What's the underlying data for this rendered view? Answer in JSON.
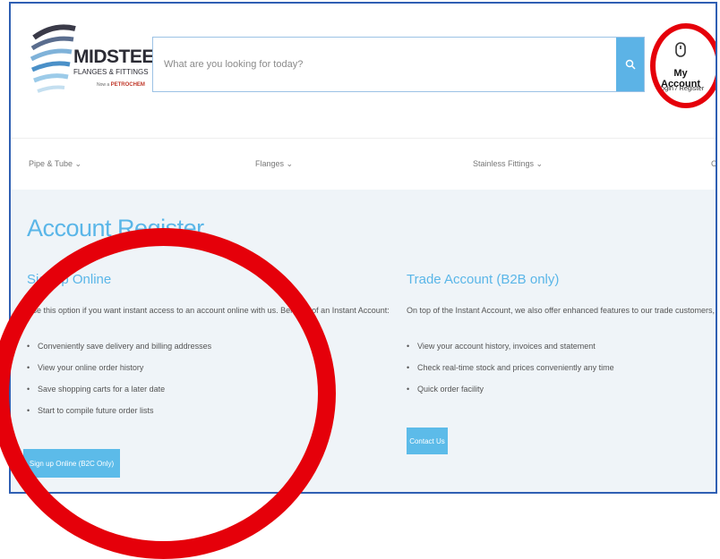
{
  "logo": {
    "name": "MIDSTEEL",
    "subtitle": "FLANGES & FITTINGS",
    "tagline_prefix": "Now a",
    "tagline_brand": "PETROCHEM"
  },
  "search": {
    "placeholder": "What are you looking for today?",
    "icon": "search-icon"
  },
  "account": {
    "icon": "user-icon",
    "title": "My Account",
    "subtitle": "Login / Register"
  },
  "nav": {
    "items": [
      {
        "label": "Pipe & Tube ⌄"
      },
      {
        "label": "Flanges ⌄"
      },
      {
        "label": "Stainless Fittings ⌄"
      },
      {
        "label": "C"
      }
    ]
  },
  "page": {
    "title": "Account Register"
  },
  "signup": {
    "title": "Signup Online",
    "intro": "Use this option if you want instant access to an account online with us. Benefits of an Instant Account:",
    "bullets": [
      "Conveniently save delivery and billing addresses",
      "View your online order history",
      "Save shopping carts for a later date",
      "Start to compile future order lists"
    ],
    "button": "Sign up Online (B2C Only)"
  },
  "trade": {
    "title": "Trade Account (B2B only)",
    "intro": "On top of the Instant Account, we also offer enhanced features to our trade customers, including:",
    "bullets": [
      "View your account history, invoices and statement",
      "Check real-time stock and prices conveniently any time",
      "Quick order facility"
    ],
    "button": "Contact Us"
  },
  "colors": {
    "accent": "#5ab6e8",
    "annotation": "#e5000a",
    "frame": "#2f5fb3"
  }
}
